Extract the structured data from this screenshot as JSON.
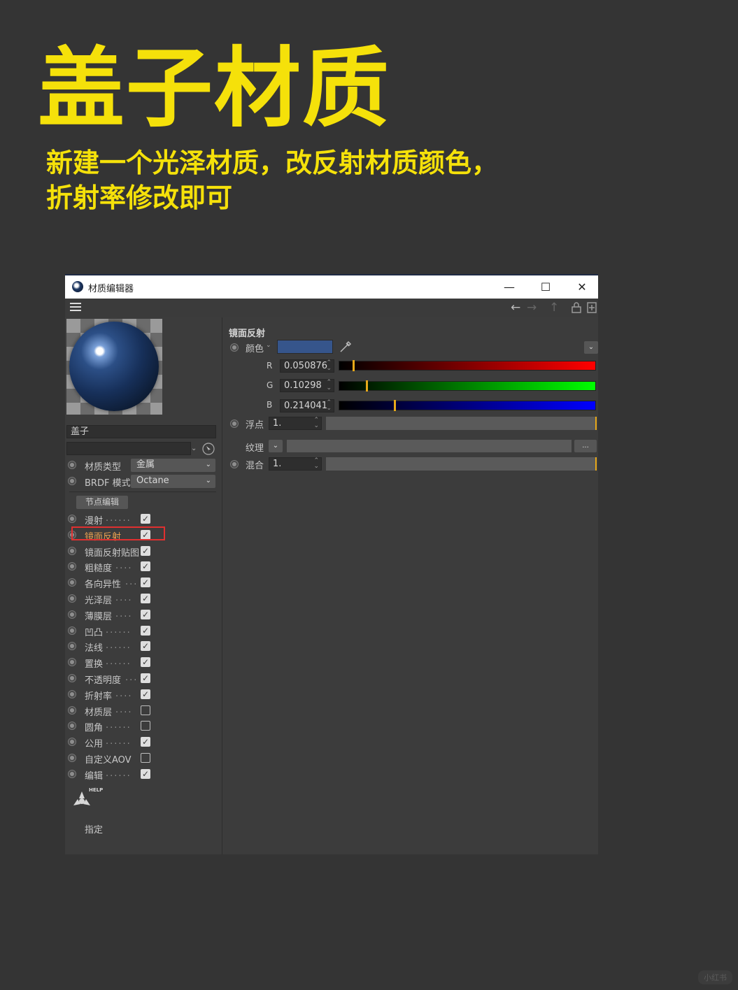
{
  "poster": {
    "title": "盖子材质",
    "subtitle_line1": "新建一个光泽材质，改反射材质颜色，",
    "subtitle_line2": "折射率修改即可"
  },
  "window": {
    "title": "材质编辑器",
    "minimize": "—",
    "maximize": "☐",
    "close": "✕"
  },
  "left": {
    "material_name": "盖子",
    "material_type_label": "材质类型",
    "material_type_value": "金属",
    "brdf_label": "BRDF 模式",
    "brdf_value": "Octane",
    "node_edit_button": "节点编辑",
    "channels": [
      {
        "label": "漫射",
        "dots": "......",
        "checked": true
      },
      {
        "label": "镜面反射",
        "dots": "",
        "checked": true
      },
      {
        "label": "镜面反射贴图",
        "dots": "",
        "checked": true
      },
      {
        "label": "粗糙度",
        "dots": "....",
        "checked": true
      },
      {
        "label": "各向异性",
        "dots": "...",
        "checked": true
      },
      {
        "label": "光泽层",
        "dots": "....",
        "checked": true
      },
      {
        "label": "薄膜层",
        "dots": "....",
        "checked": true
      },
      {
        "label": "凹凸",
        "dots": "......",
        "checked": true
      },
      {
        "label": "法线",
        "dots": "......",
        "checked": true
      },
      {
        "label": "置换",
        "dots": "......",
        "checked": true
      },
      {
        "label": "不透明度",
        "dots": "...",
        "checked": true
      },
      {
        "label": "折射率",
        "dots": "....",
        "checked": true
      },
      {
        "label": "材质层",
        "dots": "....",
        "checked": false
      },
      {
        "label": "圆角",
        "dots": "......",
        "checked": false
      },
      {
        "label": "公用",
        "dots": "......",
        "checked": true
      },
      {
        "label": "自定义AOV",
        "dots": "",
        "checked": false
      },
      {
        "label": "编辑",
        "dots": "......",
        "checked": true
      }
    ],
    "help_text": "HELP",
    "assign_label": "指定"
  },
  "right": {
    "section_title": "镜面反射",
    "color_label": "颜色",
    "color_swatch": "#36558b",
    "r_label": "R",
    "r_value": "0.050876",
    "r_level": 0.050876,
    "g_label": "G",
    "g_value": "0.10298",
    "g_level": 0.10298,
    "b_label": "B",
    "b_value": "0.214041",
    "b_level": 0.214041,
    "float_label": "浮点",
    "float_value": "1.",
    "texture_label": "纹理",
    "texture_more": "...",
    "mix_label": "混合",
    "mix_value": "1."
  },
  "watermark": "小红书"
}
